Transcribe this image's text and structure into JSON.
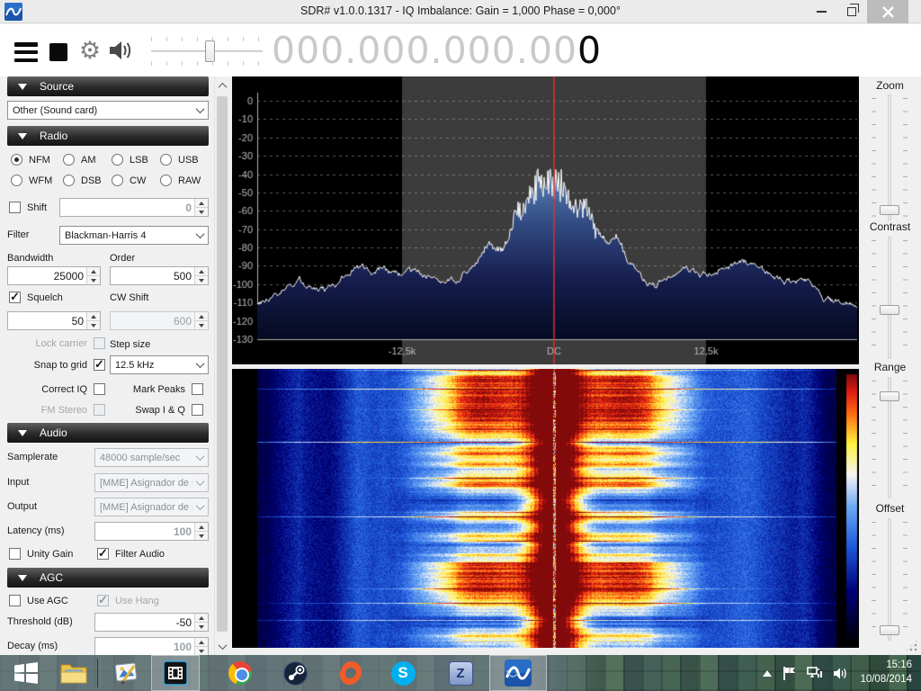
{
  "window": {
    "title": "SDR# v1.0.0.1317 - IQ Imbalance: Gain = 1,000 Phase = 0,000°"
  },
  "toolbar": {
    "frequency_digits": "000.000.000.00",
    "frequency_active_digit": "0"
  },
  "sidebar": {
    "source": {
      "header": "Source",
      "device": "Other (Sound card)"
    },
    "radio": {
      "header": "Radio",
      "modes": [
        {
          "label": "NFM",
          "selected": true
        },
        {
          "label": "AM",
          "selected": false
        },
        {
          "label": "LSB",
          "selected": false
        },
        {
          "label": "USB",
          "selected": false
        },
        {
          "label": "WFM",
          "selected": false
        },
        {
          "label": "DSB",
          "selected": false
        },
        {
          "label": "CW",
          "selected": false
        },
        {
          "label": "RAW",
          "selected": false
        }
      ],
      "shift": {
        "label": "Shift",
        "checked": false,
        "value": "0",
        "value_enabled": false
      },
      "filter": {
        "label": "Filter",
        "value": "Blackman-Harris 4"
      },
      "bandwidth": {
        "label": "Bandwidth",
        "value": "25000"
      },
      "order": {
        "label": "Order",
        "value": "500"
      },
      "squelch": {
        "label": "Squelch",
        "checked": true,
        "value": "50"
      },
      "cw_shift": {
        "label": "CW Shift",
        "value": "600",
        "enabled": false
      },
      "lock_carrier": {
        "label": "Lock carrier",
        "checked": false,
        "enabled": false
      },
      "step_size": {
        "label": "Step size",
        "value": "12.5 kHz"
      },
      "snap_to_grid": {
        "label": "Snap to grid",
        "checked": true
      },
      "correct_iq": {
        "label": "Correct IQ",
        "checked": false
      },
      "mark_peaks": {
        "label": "Mark Peaks",
        "checked": false
      },
      "fm_stereo": {
        "label": "FM Stereo",
        "checked": false,
        "enabled": false
      },
      "swap_iq": {
        "label": "Swap I & Q",
        "checked": false
      }
    },
    "audio": {
      "header": "Audio",
      "samplerate": {
        "label": "Samplerate",
        "value": "48000 sample/sec",
        "enabled": false
      },
      "input": {
        "label": "Input",
        "value": "[MME] Asignador de so",
        "enabled": false
      },
      "output": {
        "label": "Output",
        "value": "[MME] Asignador de so",
        "enabled": false
      },
      "latency": {
        "label": "Latency (ms)",
        "value": "100"
      },
      "unity_gain": {
        "label": "Unity Gain",
        "checked": false
      },
      "filter_audio": {
        "label": "Filter Audio",
        "checked": true
      }
    },
    "agc": {
      "header": "AGC",
      "use_agc": {
        "label": "Use AGC",
        "checked": false
      },
      "use_hang": {
        "label": "Use Hang",
        "checked": true,
        "enabled": false
      },
      "threshold": {
        "label": "Threshold (dB)",
        "value": "-50"
      },
      "decay": {
        "label": "Decay (ms)",
        "value": "100"
      }
    }
  },
  "display_controls": {
    "zoom": "Zoom",
    "contrast": "Contrast",
    "range": "Range",
    "offset": "Offset"
  },
  "chart_data": [
    {
      "type": "line",
      "name": "fft-spectrum",
      "ylabel": "dB",
      "ylim": [
        -130,
        0
      ],
      "y_ticks": [
        0,
        -10,
        -20,
        -30,
        -40,
        -50,
        -60,
        -70,
        -80,
        -90,
        -100,
        -110,
        -120,
        -130
      ],
      "x_ticks": [
        {
          "f": -12.5,
          "label": "-12,5k"
        },
        {
          "f": 0,
          "label": "DC"
        },
        {
          "f": 12.5,
          "label": "12,5k"
        }
      ],
      "xlim_khz": [
        -24.4,
        24.9
      ],
      "band_khz": [
        -12.5,
        12.5
      ],
      "band_color": "#3c3c3c",
      "tuning_line_color": "#d03434",
      "trace_color": "#fafafa",
      "fill_gradient": [
        "#8fb8dc",
        "#5d88ba",
        "#324a82",
        "#161e4e",
        "#060a22"
      ],
      "grid": true,
      "series": [
        {
          "name": "power_dB",
          "points": [
            [
              -24.5,
              -111
            ],
            [
              -23.5,
              -108
            ],
            [
              -22.5,
              -103
            ],
            [
              -21.5,
              -99
            ],
            [
              -21,
              -97
            ],
            [
              -20.5,
              -100
            ],
            [
              -19.5,
              -102
            ],
            [
              -18.5,
              -103
            ],
            [
              -18,
              -101
            ],
            [
              -17,
              -95
            ],
            [
              -16.2,
              -90
            ],
            [
              -15.5,
              -91
            ],
            [
              -15,
              -93
            ],
            [
              -14,
              -92
            ],
            [
              -13.5,
              -94
            ],
            [
              -12.5,
              -95
            ],
            [
              -11.5,
              -94
            ],
            [
              -10.5,
              -95
            ],
            [
              -9.5,
              -96
            ],
            [
              -8.8,
              -99
            ],
            [
              -8.2,
              -98
            ],
            [
              -7.5,
              -95
            ],
            [
              -6.8,
              -93
            ],
            [
              -6.2,
              -87
            ],
            [
              -5.6,
              -80
            ],
            [
              -5.2,
              -78
            ],
            [
              -4.6,
              -79
            ],
            [
              -4.2,
              -81
            ],
            [
              -3.8,
              -78
            ],
            [
              -3.4,
              -70
            ],
            [
              -3.0,
              -62
            ],
            [
              -2.6,
              -58
            ],
            [
              -2.2,
              -55
            ],
            [
              -1.8,
              -52
            ],
            [
              -1.4,
              -50
            ],
            [
              -1.0,
              -48
            ],
            [
              -0.6,
              -44
            ],
            [
              -0.3,
              -40
            ],
            [
              0,
              -42
            ],
            [
              0.3,
              -39
            ],
            [
              0.6,
              -45
            ],
            [
              0.9,
              -50
            ],
            [
              1.3,
              -52
            ],
            [
              1.7,
              -55
            ],
            [
              2.1,
              -58
            ],
            [
              2.5,
              -56
            ],
            [
              2.9,
              -62
            ],
            [
              3.3,
              -68
            ],
            [
              3.7,
              -74
            ],
            [
              4.1,
              -78
            ],
            [
              4.5,
              -80
            ],
            [
              5.0,
              -78
            ],
            [
              5.4,
              -80
            ],
            [
              5.9,
              -85
            ],
            [
              6.4,
              -90
            ],
            [
              7.0,
              -95
            ],
            [
              7.6,
              -98
            ],
            [
              8.2,
              -100
            ],
            [
              9.0,
              -98
            ],
            [
              9.6,
              -96
            ],
            [
              10.4,
              -95
            ],
            [
              11.2,
              -94
            ],
            [
              12.0,
              -95
            ],
            [
              12.5,
              -95
            ],
            [
              13.2,
              -93
            ],
            [
              14.0,
              -92
            ],
            [
              14.8,
              -90
            ],
            [
              15.6,
              -89
            ],
            [
              16.4,
              -90
            ],
            [
              17.2,
              -93
            ],
            [
              18.0,
              -95
            ],
            [
              18.8,
              -97
            ],
            [
              19.6,
              -99
            ],
            [
              20.4,
              -97
            ],
            [
              21.0,
              -99
            ],
            [
              21.6,
              -103
            ],
            [
              22.2,
              -107
            ],
            [
              23.0,
              -110
            ],
            [
              23.8,
              -108
            ],
            [
              24.5,
              -110
            ]
          ]
        }
      ]
    },
    {
      "type": "heatmap",
      "name": "waterfall",
      "x_range_khz": [
        -24.4,
        23.2
      ],
      "carrier_khz": 0,
      "palette": [
        [
          0,
          "#000010"
        ],
        [
          0.18,
          "#000078"
        ],
        [
          0.35,
          "#1e5adc"
        ],
        [
          0.5,
          "#6eaaf5"
        ],
        [
          0.62,
          "#f5f5f5"
        ],
        [
          0.74,
          "#fff03c"
        ],
        [
          0.85,
          "#ff6e14"
        ],
        [
          0.93,
          "#e11e14"
        ],
        [
          1,
          "#820a0a"
        ]
      ],
      "colorbar": true
    }
  ],
  "taskbar": {
    "apps": [
      "start",
      "file-explorer",
      "image-editor",
      "video-editor",
      "chrome",
      "steam",
      "origin",
      "skype",
      "zadig",
      "sdrsharp"
    ],
    "skype_letter": "S",
    "zadig_letter": "Z",
    "tray": [
      "tray-expand",
      "action-center-flag",
      "network",
      "volume"
    ],
    "time": "15:16",
    "date": "10/08/2014"
  }
}
